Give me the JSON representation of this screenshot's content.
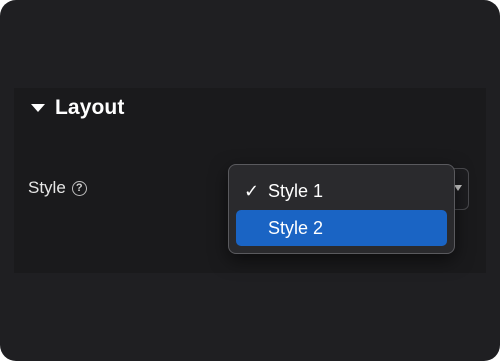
{
  "section": {
    "title": "Layout",
    "expanded": true
  },
  "field": {
    "label": "Style",
    "help_icon": "question-circle-icon",
    "help_glyph": "?"
  },
  "dropdown": {
    "selected": "Style 1",
    "highlighted": "Style 2",
    "check_glyph": "✓",
    "options": [
      {
        "label": "Style 1",
        "checked": true
      },
      {
        "label": "Style 2",
        "checked": false
      }
    ]
  },
  "colors": {
    "background": "#1f1f22",
    "highlight": "#1a64c4",
    "text": "#ffffff"
  }
}
